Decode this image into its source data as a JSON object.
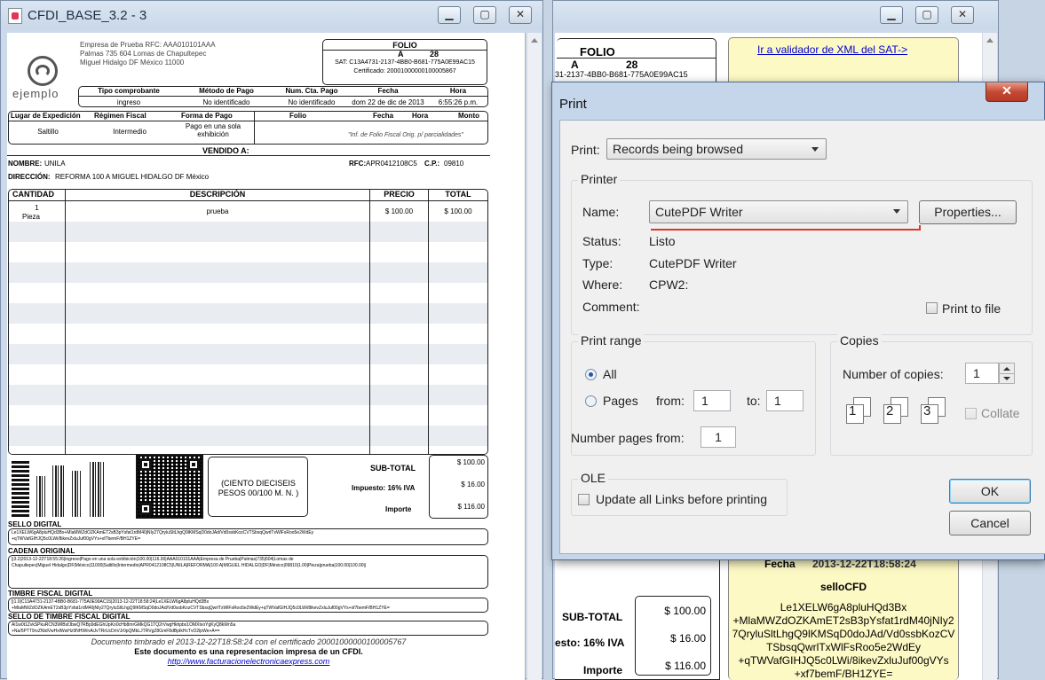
{
  "left_window": {
    "title": "CFDI_BASE_3.2 - 3",
    "issuer": {
      "name_line": "Empresa de Prueba RFC: AAA010101AAA",
      "address1": "Palmas 735 604 Lomas de Chapultepec",
      "address2": "Miguel Hidalgo DF México 11000",
      "logo_text": "ejemplo"
    },
    "folio": {
      "label": "FOLIO",
      "serie": "A",
      "number": "28",
      "sat": "SAT: C13A4731-2137-4BB0-B681-775A0E99AC15",
      "cert": "Certificado: 20001000000100005867"
    },
    "header_row1": {
      "labels": [
        "Tipo comprobante",
        "Método de Pago",
        "Num. Cta. Pago",
        "Fecha",
        "Hora"
      ],
      "values": [
        "ingreso",
        "No identificado",
        "No identificado",
        "dom 22 de dic de 2013",
        "6:55:26 p.m."
      ]
    },
    "header_row2": {
      "labels": [
        "Lugar de Expedición",
        "Régimen Fiscal",
        "Forma de Pago",
        "Folio",
        "Fecha",
        "Hora",
        "Monto"
      ],
      "values": [
        "Saltillo",
        "Intermedio",
        "Pago en una sola exhibición",
        "\"Inf. de Folio Fiscal Orig. p/ parcialidades\""
      ]
    },
    "vendido": {
      "title": "VENDIDO A:",
      "nombre_label": "NOMBRE:",
      "nombre": "UNILA",
      "rfc_label": "RFC:",
      "rfc": "APR0412108C5",
      "cp_label": "C.P.:",
      "cp": "09810",
      "direccion_label": "DIRECCIÓN:",
      "direccion": "REFORMA 100 A MIGUEL HIDALGO DF México"
    },
    "items_header": [
      "CANTIDAD",
      "DESCRIPCIÓN",
      "PRECIO",
      "TOTAL"
    ],
    "items": [
      {
        "cantidad": "1",
        "unidad": "Pieza",
        "descripcion": "prueba",
        "precio": "$ 100.00",
        "total": "$ 100.00"
      }
    ],
    "amount_words": "(CIENTO DIECISEIS PESOS 00/100 M. N. )",
    "totals": {
      "subtotal_label": "SUB-TOTAL",
      "subtotal": "$ 100.00",
      "iva_label": "Impuesto: 16% IVA",
      "iva": "$ 16.00",
      "importe_label": "Importe",
      "importe": "$ 116.00"
    },
    "sello_digital": {
      "title": "SELLO DIGITAL",
      "line1": "Le1XELW6gA8pluHQd3Bx+MlaMWZdOZKAmET2sB3pYsfat1rdM40jNIy27QryluSltLhgQ9lKMSqD0doJAd/Vd0ssbKozCVTSbsqQwrlTxWlFsRoo5e2WdEy",
      "line2": "+qTWVafGIHJQ5c0LWi/8ikevZxluJuf00gVYs+xf7bemF/BH1ZYE="
    },
    "cadena_original": {
      "title": "CADENA ORIGINAL",
      "line1": "||3.2|2013-12-22T18:55:26|ingreso|Pago en una sola exhibición|100.00|116.00|AAA010101AAA|Empresa de Prueba|Palmas|735|604|Lomas de",
      "line2": "Chapultepec|Miguel Hidalgo|DF|México|11000|Saltillo|Intermedio|APR0412108C5|UNILA|REFORMA|100 A|MIGUEL HIDALGO|DF|México|09810|1.00|Pieza|prueba|100.00|100.00||"
    },
    "timbre_fiscal": {
      "title": "TIMBRE FISCAL DIGITAL",
      "line1": "||1.0|C13A4731-2137-4BB0-B681-775A0E99AC15|2013-12-22T18:58:24|Le1XELW6gA8pluHQd3Bx",
      "line2": "+MlaMWZdOZKAmET2sB3pYsfat1rdM40jNIy27QryluSltLhgQ9lKMSqD0doJAd/Vd0ssbKozCVTSbsqQwrlTxWlFsRoo5e2WdEy+qTWVafGIHJQ5c0LWi/8ikevZxluJuf00gVYs+xf7bemF/BH1ZYE="
    },
    "sello_timbre": {
      "title": "SELLO DE TIMBRE FISCAL DIGITAL",
      "line1": "Al1w0t1ZvkSPkuRCN3WlBsfJbwQ7RBp9dEGhUpKo0cHb8mrGMkQG1TQ2rVwgHkhpbx1OMXtvoYgKyQ8kWn5a",
      "line2": "+Na/5PTT9rvZNtdVwHxlWwHz9NHW/nAiJvTRrUcDnVJr0pQMbLJTRVgZ8GmF8dBpIkHcTvO2lpWe+A=="
    },
    "footer": {
      "line1": "Documento timbrado el 2013-12-22T18:58:24 con el certificado 20001000000100005767",
      "line2": "Este documento es una representacion impresa de un CFDI.",
      "link": "http://www.facturacionelectronicaexpress.com"
    }
  },
  "right_window": {
    "folio_label": "FOLIO",
    "serie": "A",
    "number": "28",
    "uuid": "31-2137-4BB0-B681-775A0E99AC15",
    "validator_link": "Ir a validador de XML del SAT->",
    "fecha_label": "Fecha",
    "fecha": "2013-12-22T18:58:24",
    "sello_label": "selloCFD",
    "sello_lines": [
      "Le1XELW6gA8pluHQd3Bx",
      "+MlaMWZdOZKAmET2sB3pYsfat1rdM40jNIy2",
      "7QryluSltLhgQ9lKMSqD0doJAd/Vd0ssbKozCV",
      "TSbsqQwrlTxWlFsRoo5e2WdEy",
      "+qTWVafGIHJQ5c0LWi/8ikevZxluJuf00gVYs",
      "+xf7bemF/BH1ZYE="
    ],
    "subtotal_label": "SUB-TOTAL",
    "subtotal": "$ 100.00",
    "iva_label": "esto: 16% IVA",
    "iva": "$ 16.00",
    "importe_label": "Importe",
    "importe": "$ 116.00"
  },
  "print_dialog": {
    "title": "Print",
    "print_label": "Print:",
    "print_value": "Records being browsed",
    "printer_group": "Printer",
    "name_label": "Name:",
    "name_value": "CutePDF Writer",
    "properties_button": "Properties...",
    "status_label": "Status:",
    "status_value": "Listo",
    "type_label": "Type:",
    "type_value": "CutePDF Writer",
    "where_label": "Where:",
    "where_value": "CPW2:",
    "comment_label": "Comment:",
    "print_to_file": "Print to file",
    "range_group": "Print range",
    "all_label": "All",
    "pages_label": "Pages",
    "from_label": "from:",
    "from_value": "1",
    "to_label": "to:",
    "to_value": "1",
    "copies_group": "Copies",
    "num_copies_label": "Number of copies:",
    "num_copies_value": "1",
    "collate_label": "Collate",
    "number_pages_label": "Number pages from:",
    "number_pages_value": "1",
    "ole_group": "OLE",
    "update_links_label": "Update all Links before printing",
    "ok_button": "OK",
    "cancel_button": "Cancel",
    "accent": "#c13b2a"
  }
}
